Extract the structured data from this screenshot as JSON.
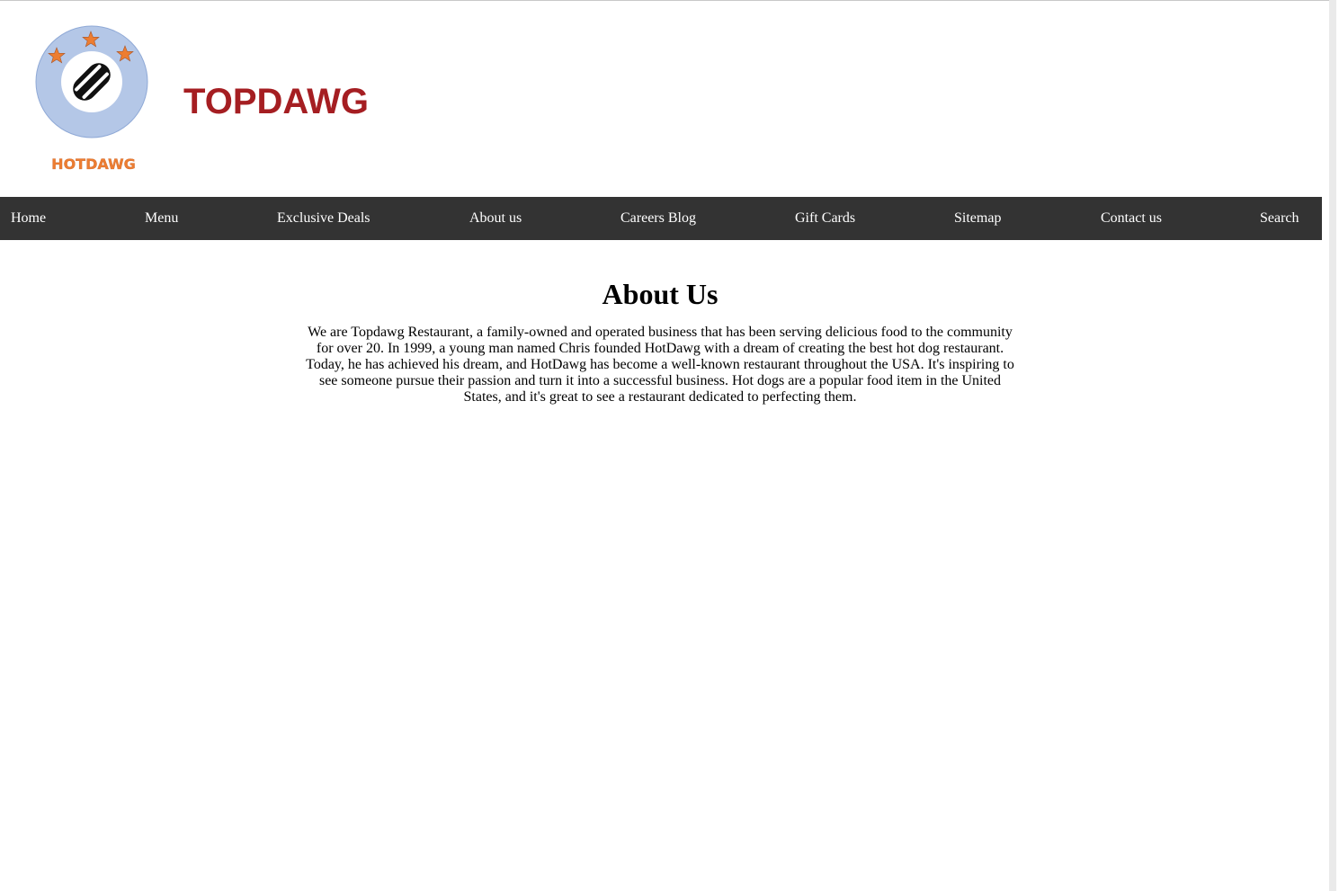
{
  "header": {
    "logo_text": "HOTDAWG",
    "site_title": "TOPDAWG"
  },
  "nav": {
    "items": [
      {
        "label": "Home"
      },
      {
        "label": "Menu"
      },
      {
        "label": "Exclusive Deals"
      },
      {
        "label": "About us"
      },
      {
        "label": "Careers Blog"
      },
      {
        "label": "Gift Cards"
      },
      {
        "label": "Sitemap"
      },
      {
        "label": "Contact us"
      },
      {
        "label": "Search"
      }
    ]
  },
  "main": {
    "heading": "About Us",
    "paragraph": "We are Topdawg Restaurant, a family-owned and operated business that has been serving delicious food to the community for over 20. In 1999, a young man named Chris founded HotDawg with a dream of creating the best hot dog restaurant. Today, he has achieved his dream, and HotDawg has become a well-known restaurant throughout the USA. It's inspiring to see someone pursue their passion and turn it into a successful business. Hot dogs are a popular food item in the United States, and it's great to see a restaurant dedicated to perfecting them."
  },
  "colors": {
    "title": "#a51e22",
    "nav_background": "#333333",
    "nav_text": "#ffffff",
    "logo_ring": "#b4c7e7",
    "logo_star": "#ed7d31"
  }
}
